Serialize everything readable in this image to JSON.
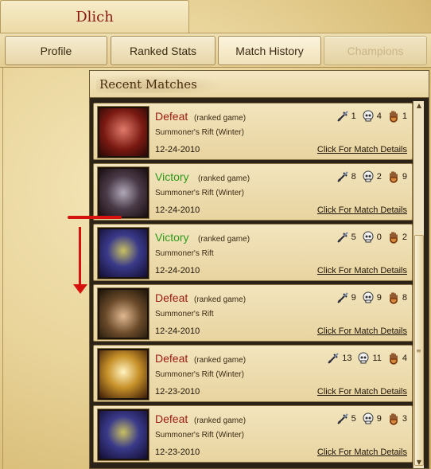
{
  "window": {
    "title": "Dlich"
  },
  "tabs": [
    {
      "label": "Profile",
      "state": "normal"
    },
    {
      "label": "Ranked Stats",
      "state": "normal"
    },
    {
      "label": "Match History",
      "state": "active"
    },
    {
      "label": "Champions",
      "state": "disabled"
    }
  ],
  "panel": {
    "title": "Recent Matches"
  },
  "colors": {
    "defeat": "#9b1a10",
    "victory": "#2c9a18",
    "title": "#8b1a12",
    "annotation": "#d6120e"
  },
  "icons": {
    "kills": "sword-icon",
    "deaths": "skull-icon",
    "assists": "hand-icon"
  },
  "matches": [
    {
      "result": "Defeat",
      "result_class": "defeat",
      "game_type": "(ranked game)",
      "map": "Summoner's Rift (Winter)",
      "date": "12-24-2010",
      "kills": "1",
      "deaths": "4",
      "assists": "1",
      "details": "Click For Match Details",
      "champion_icon": "champion-portrait-red-beast"
    },
    {
      "result": "Victory",
      "result_class": "victory",
      "game_type": "(ranked game)",
      "map": "Summoner's Rift (Winter)",
      "date": "12-24-2010",
      "kills": "8",
      "deaths": "2",
      "assists": "9",
      "details": "Click For Match Details",
      "champion_icon": "champion-portrait-wolf"
    },
    {
      "result": "Victory",
      "result_class": "victory",
      "game_type": "(ranked game)",
      "map": "Summoner's Rift",
      "date": "12-24-2010",
      "kills": "5",
      "deaths": "0",
      "assists": "2",
      "details": "Click For Match Details",
      "champion_icon": "champion-portrait-dark-mage"
    },
    {
      "result": "Defeat",
      "result_class": "defeat",
      "game_type": "(ranked game)",
      "map": "Summoner's Rift",
      "date": "12-24-2010",
      "kills": "9",
      "deaths": "9",
      "assists": "8",
      "details": "Click For Match Details",
      "champion_icon": "champion-portrait-hooded-archer"
    },
    {
      "result": "Defeat",
      "result_class": "defeat",
      "game_type": "(ranked game)",
      "map": "Summoner's Rift (Winter)",
      "date": "12-23-2010",
      "kills": "13",
      "deaths": "11",
      "assists": "4",
      "details": "Click For Match Details",
      "champion_icon": "champion-portrait-gold-helmet"
    },
    {
      "result": "Defeat",
      "result_class": "defeat",
      "game_type": "(ranked game)",
      "map": "Summoner's Rift (Winter)",
      "date": "12-23-2010",
      "kills": "5",
      "deaths": "9",
      "assists": "3",
      "details": "Click For Match Details",
      "champion_icon": "champion-portrait-dark-mage"
    }
  ]
}
